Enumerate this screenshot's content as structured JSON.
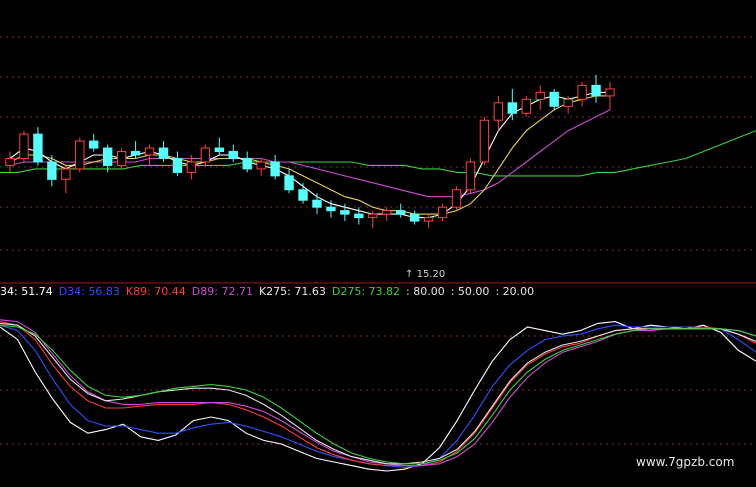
{
  "kdj_legend": [
    {
      "text": "34: 51.74",
      "color": "#ffffff"
    },
    {
      "text": "D34: 56.83",
      "color": "#2f52ff"
    },
    {
      "text": "K89: 70.44",
      "color": "#ff3b3b"
    },
    {
      "text": "D89: 72.71",
      "color": "#cf4bd6"
    },
    {
      "text": "K275: 71.63",
      "color": "#e6e6e6"
    },
    {
      "text": "D275: 73.82",
      "color": "#3fcf3f"
    },
    {
      "text": ": 80.00",
      "color": "#e6e6e6"
    },
    {
      "text": ": 50.00",
      "color": "#e6e6e6"
    },
    {
      "text": ": 20.00",
      "color": "#e6e6e6"
    }
  ],
  "low_price_label": "15.20",
  "watermark": "www.7gpzb.com",
  "colors": {
    "up_candle": "#ff4040",
    "down_candle": "#54ffff",
    "ma_short": "#ffffff",
    "ma_mid": "#e6d34a",
    "ma_long": "#cf4bd6",
    "ma_very_long": "#3fcf3f",
    "grid": "#8b2a2a",
    "separator": "#a01818"
  },
  "chart_data": [
    {
      "type": "candlestick",
      "title": "",
      "note": "price candlesticks with moving averages (values in relative price units, 0-100 scale)",
      "candles": [
        [
          20,
          24,
          18,
          22
        ],
        [
          22,
          30,
          21,
          29
        ],
        [
          29,
          31,
          20,
          21
        ],
        [
          21,
          23,
          14,
          16
        ],
        [
          16,
          20,
          12,
          19
        ],
        [
          19,
          28,
          18,
          27
        ],
        [
          27,
          29,
          24,
          25
        ],
        [
          25,
          26,
          18,
          20
        ],
        [
          20,
          25,
          19,
          24
        ],
        [
          24,
          27,
          22,
          23
        ],
        [
          23,
          26,
          20,
          25
        ],
        [
          25,
          27,
          21,
          22
        ],
        [
          22,
          24,
          17,
          18
        ],
        [
          18,
          23,
          16,
          21
        ],
        [
          21,
          26,
          20,
          25
        ],
        [
          25,
          28,
          23,
          24
        ],
        [
          24,
          26,
          21,
          22
        ],
        [
          22,
          24,
          18,
          19
        ],
        [
          19,
          22,
          17,
          21
        ],
        [
          21,
          23,
          16,
          17
        ],
        [
          17,
          19,
          12,
          13
        ],
        [
          13,
          15,
          9,
          10
        ],
        [
          10,
          12,
          6,
          8
        ],
        [
          8,
          10,
          5,
          7
        ],
        [
          7,
          9,
          4,
          6
        ],
        [
          6,
          8,
          3,
          5
        ],
        [
          5,
          7,
          2,
          6
        ],
        [
          6,
          8,
          4,
          7
        ],
        [
          7,
          9,
          5,
          6
        ],
        [
          6,
          7,
          3,
          4
        ],
        [
          4,
          6,
          2,
          5
        ],
        [
          5,
          9,
          4,
          8
        ],
        [
          8,
          14,
          7,
          13
        ],
        [
          13,
          22,
          12,
          21
        ],
        [
          21,
          34,
          20,
          33
        ],
        [
          33,
          40,
          30,
          38
        ],
        [
          38,
          42,
          33,
          35
        ],
        [
          35,
          40,
          34,
          39
        ],
        [
          39,
          43,
          36,
          41
        ],
        [
          41,
          42,
          36,
          37
        ],
        [
          37,
          40,
          35,
          39
        ],
        [
          39,
          44,
          37,
          43
        ],
        [
          43,
          46,
          38,
          40
        ],
        [
          40,
          44,
          36,
          42
        ]
      ],
      "ma_short": [
        22,
        25,
        24,
        21,
        19,
        21,
        23,
        23,
        22,
        23,
        24,
        23,
        21,
        20,
        21,
        23,
        23,
        21,
        20,
        19,
        17,
        14,
        11,
        9,
        8,
        7,
        6,
        6,
        6,
        5,
        5,
        6,
        9,
        14,
        22,
        30,
        35,
        37,
        39,
        40,
        39,
        40,
        41,
        41
      ],
      "ma_mid": [
        21,
        23,
        23,
        22,
        20,
        20,
        21,
        22,
        22,
        22,
        23,
        23,
        22,
        21,
        21,
        22,
        22,
        22,
        21,
        20,
        19,
        17,
        15,
        13,
        11,
        10,
        8,
        7,
        7,
        6,
        6,
        6,
        7,
        9,
        13,
        19,
        25,
        30,
        33,
        36,
        38,
        39,
        40,
        40
      ],
      "ma_long": [
        20,
        21,
        21,
        21,
        21,
        21,
        21,
        21,
        21,
        21,
        22,
        22,
        22,
        22,
        22,
        22,
        22,
        22,
        22,
        21,
        21,
        20,
        19,
        18,
        17,
        16,
        15,
        14,
        13,
        12,
        11,
        11,
        11,
        12,
        13,
        15,
        18,
        21,
        24,
        27,
        30,
        32,
        34,
        36
      ],
      "ma_very_long": [
        18,
        18,
        19,
        19,
        19,
        19,
        19,
        19,
        20,
        20,
        20,
        20,
        20,
        20,
        21,
        21,
        21,
        21,
        21,
        21,
        21,
        20,
        20,
        20,
        19,
        19,
        18,
        18,
        17,
        17,
        17,
        17,
        17,
        17,
        18,
        18,
        19,
        20,
        21,
        22,
        24,
        26,
        28,
        30
      ],
      "annotations": [
        "15.20"
      ]
    },
    {
      "type": "line",
      "title": "",
      "note": "multi-period KDJ oscillator",
      "ylim": [
        0,
        100
      ],
      "reference_lines": [
        80,
        50,
        20
      ],
      "series": [
        {
          "name": "34",
          "values": [
            85,
            78,
            60,
            45,
            32,
            26,
            28,
            31,
            24,
            22,
            25,
            33,
            35,
            33,
            26,
            22,
            20,
            16,
            12,
            10,
            8,
            6,
            5,
            6,
            9,
            18,
            33,
            50,
            66,
            78,
            85,
            83,
            81,
            83,
            87,
            88,
            84,
            86,
            85,
            84,
            86,
            82,
            72,
            66
          ]
        },
        {
          "name": "D34",
          "values": [
            86,
            83,
            72,
            56,
            42,
            33,
            30,
            30,
            28,
            26,
            26,
            29,
            31,
            32,
            30,
            27,
            24,
            20,
            16,
            13,
            11,
            9,
            8,
            7,
            8,
            12,
            22,
            36,
            52,
            64,
            72,
            78,
            80,
            81,
            84,
            86,
            85,
            85,
            85,
            85,
            85,
            84,
            78,
            71
          ]
        },
        {
          "name": "K89",
          "values": [
            88,
            86,
            78,
            64,
            52,
            44,
            40,
            40,
            41,
            42,
            42,
            42,
            43,
            42,
            39,
            35,
            30,
            24,
            18,
            14,
            11,
            9,
            8,
            8,
            8,
            10,
            16,
            26,
            40,
            54,
            64,
            70,
            74,
            76,
            80,
            83,
            84,
            84,
            84,
            84,
            85,
            84,
            81,
            76
          ]
        },
        {
          "name": "D89",
          "values": [
            89,
            88,
            82,
            70,
            58,
            49,
            44,
            42,
            42,
            43,
            43,
            43,
            43,
            43,
            41,
            38,
            33,
            27,
            21,
            16,
            13,
            10,
            9,
            8,
            8,
            9,
            13,
            20,
            32,
            46,
            57,
            65,
            71,
            74,
            77,
            81,
            83,
            83,
            84,
            84,
            84,
            84,
            83,
            80
          ]
        },
        {
          "name": "K275",
          "values": [
            87,
            86,
            80,
            68,
            56,
            48,
            44,
            45,
            47,
            49,
            50,
            51,
            51,
            50,
            47,
            42,
            36,
            29,
            22,
            17,
            13,
            11,
            9,
            9,
            10,
            12,
            17,
            27,
            41,
            55,
            65,
            71,
            75,
            77,
            80,
            83,
            84,
            84,
            84,
            84,
            84,
            84,
            81,
            77
          ]
        },
        {
          "name": "D275",
          "values": [
            86,
            85,
            81,
            72,
            61,
            52,
            47,
            46,
            47,
            49,
            51,
            52,
            53,
            52,
            50,
            46,
            40,
            33,
            26,
            20,
            15,
            12,
            10,
            9,
            9,
            11,
            15,
            23,
            36,
            50,
            60,
            67,
            72,
            75,
            78,
            81,
            83,
            84,
            84,
            84,
            84,
            84,
            83,
            80
          ]
        }
      ]
    }
  ]
}
